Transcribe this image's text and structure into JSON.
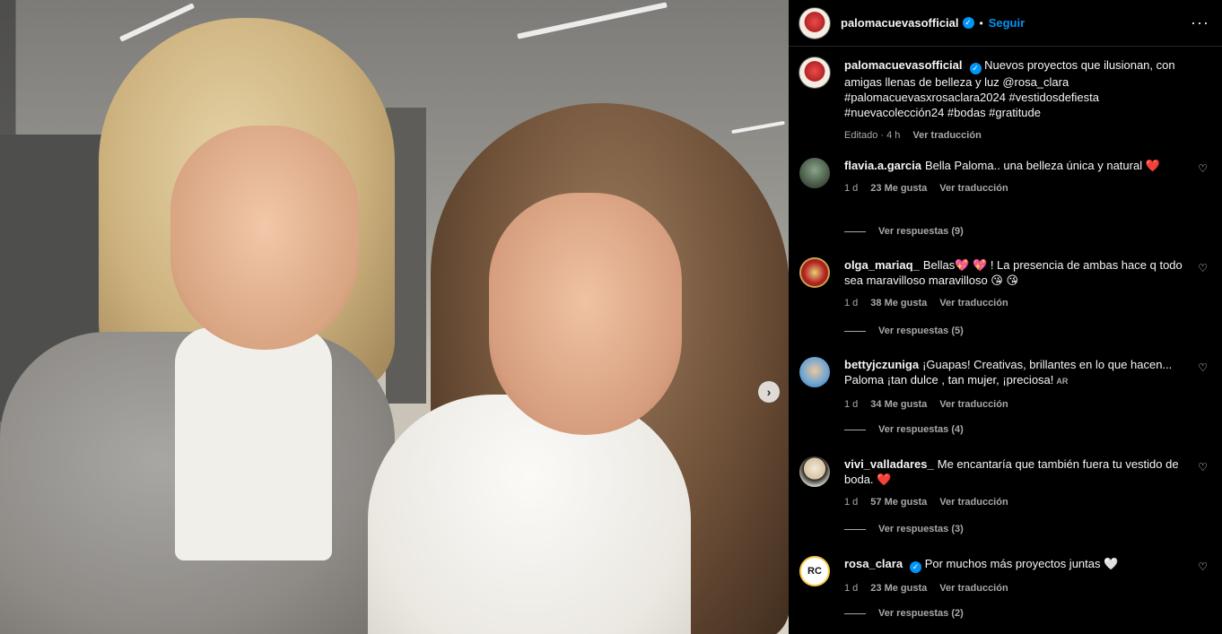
{
  "post": {
    "author": "palomacuevasofficial",
    "follow_label": "Seguir",
    "dot": "•",
    "more_icon": "more-horizontal-icon",
    "caption": {
      "username": "palomacuevasofficial",
      "text": "Nuevos proyectos que ilusionan, con amigas llenas de belleza y luz @rosa_clara #palomacuevasxrosaclara2024 #vestidosdefiesta #nuevacolección24 #bodas #gratitude",
      "edited": "Editado · 4 h",
      "translate": "Ver traducción"
    }
  },
  "media": {
    "next_label": "›"
  },
  "comments": [
    {
      "username": "flavia.a.garcia",
      "text": "Bella Paloma.. una belleza única y natural ",
      "emoji": "❤️",
      "time": "1 d",
      "likes": "23 Me gusta",
      "translate": "Ver traducción",
      "replies": "Ver respuestas (9)"
    },
    {
      "username": "olga_mariaq_",
      "text": "Bellas💖 💖 ! La presencia de ambas hace q todo sea maravilloso maravilloso 😘 😘",
      "time": "1 d",
      "likes": "38 Me gusta",
      "translate": "Ver traducción",
      "replies": "Ver respuestas (5)"
    },
    {
      "username": "bettyjczuniga",
      "text": "¡Guapas! Creativas, brillantes en lo que hacen... Paloma ¡tan dulce , tan mujer, ¡preciosa!",
      "badge": "AR",
      "time": "1 d",
      "likes": "34 Me gusta",
      "translate": "Ver traducción",
      "replies": "Ver respuestas (4)"
    },
    {
      "username": "vivi_valladares_",
      "text": "Me encantaría que también fuera tu vestido de boda. ",
      "emoji": "❤️",
      "time": "1 d",
      "likes": "57 Me gusta",
      "translate": "Ver traducción",
      "replies": "Ver respuestas (3)"
    },
    {
      "username": "rosa_clara",
      "avatar_text": "RC",
      "text": "Por muchos más proyectos juntas 🤍",
      "time": "1 d",
      "likes": "23 Me gusta",
      "translate": "Ver traducción",
      "replies": "Ver respuestas (2)"
    }
  ],
  "icons": {
    "like": "heart-outline-icon",
    "verified": "verified-badge-icon"
  }
}
